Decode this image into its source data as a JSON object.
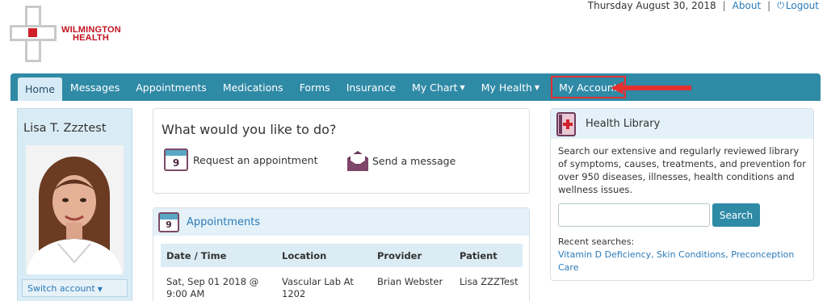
{
  "brand": {
    "logo_line1": "WILMINGTON",
    "logo_line2": "HEALTH"
  },
  "topbar": {
    "date": "Thursday August 30, 2018",
    "about": "About",
    "logout": "Logout"
  },
  "nav": {
    "home": "Home",
    "messages": "Messages",
    "appointments": "Appointments",
    "medications": "Medications",
    "forms": "Forms",
    "insurance": "Insurance",
    "my_chart": "My Chart",
    "my_health": "My Health",
    "my_account": "My Account"
  },
  "profile": {
    "name": "Lisa T. Zzztest",
    "switch_account": "Switch account"
  },
  "actions": {
    "title": "What would you like to do?",
    "request_appointment": "Request an appointment",
    "send_message": "Send a message",
    "calendar_day": "9"
  },
  "appointments": {
    "title": "Appointments",
    "columns": [
      "Date / Time",
      "Location",
      "Provider",
      "Patient"
    ],
    "rows": [
      {
        "date": "Sat, Sep 01 2018 @ 9:00 AM",
        "location": "Vascular Lab At 1202",
        "provider": "Brian Webster",
        "patient": "Lisa ZZZTest"
      }
    ]
  },
  "health_library": {
    "title": "Health Library",
    "description": "Search our extensive and regularly reviewed library of symptoms, causes, treatments, and prevention for over 950 diseases, illnesses, health conditions and wellness issues.",
    "search_placeholder": "",
    "search_button": "Search",
    "recent_label": "Recent searches:",
    "recent_searches": "Vitamin D Deficiency, Skin Conditions, Preconception Care"
  },
  "colors": {
    "nav_bg": "#2f8aa6",
    "link": "#2a7ab8",
    "highlight_border": "#e53030",
    "brand_red": "#c2111f"
  }
}
